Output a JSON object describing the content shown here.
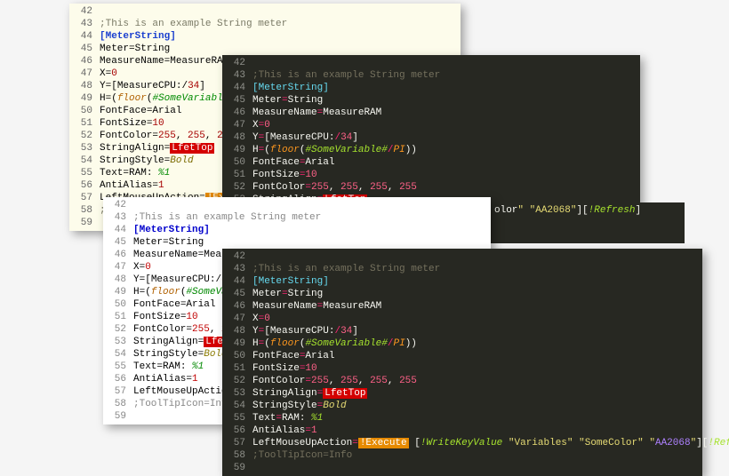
{
  "lines": {
    "start": 42,
    "end": 59
  },
  "tokens": {
    "comment": ";This is an example String meter",
    "section": "[MeterString]",
    "meter_k": "Meter",
    "meter_v": "String",
    "measurename_k": "MeasureName",
    "measurename_v": "MeasureRAM",
    "x_k": "X",
    "x_v": "0",
    "y_k": "Y",
    "y_v1": "[",
    "y_v2": "MeasureCPU:",
    "y_v3": "/",
    "y_v4": "34",
    "y_v5": "]",
    "h_k": "H",
    "h_v1": "(",
    "h_floor": "floor",
    "h_v2": "(",
    "h_var": "#SomeVariable#",
    "h_v3": "/",
    "h_pi": "PI",
    "h_v4": "))",
    "fontface_k": "FontFace",
    "fontface_v": "Arial",
    "fontsize_k": "FontSize",
    "fontsize_v": "10",
    "fontcolor_k": "FontColor",
    "fc1": "255",
    "fc2": "255",
    "fc3": "255",
    "fc4": "255",
    "sep": ", ",
    "stringalign_k": "StringAlign",
    "stringalign_err": "LfetTop",
    "stringstyle_k": "StringStyle",
    "stringstyle_v": "Bold",
    "text_k": "Text",
    "text_v": "RAM: ",
    "text_pct": "%1",
    "antialias_k": "AntiAlias",
    "antialias_v": "1",
    "leftmouse_k": "LeftMouseUpAction",
    "bang_exec": "!Execute",
    "bang_writekey": "!WriteKeyValue",
    "str_variables": "\"Variables\"",
    "str_somecolor": "\"SomeColor\"",
    "str_hex": "\"AA2068\"",
    "refresh": "!Refresh",
    "tooltip_k": ";ToolTipIcon",
    "tooltip_v": "Info",
    "eq": "=",
    "sp": " ",
    "lb": "[",
    "rb": "]",
    "rb2": "]["
  }
}
